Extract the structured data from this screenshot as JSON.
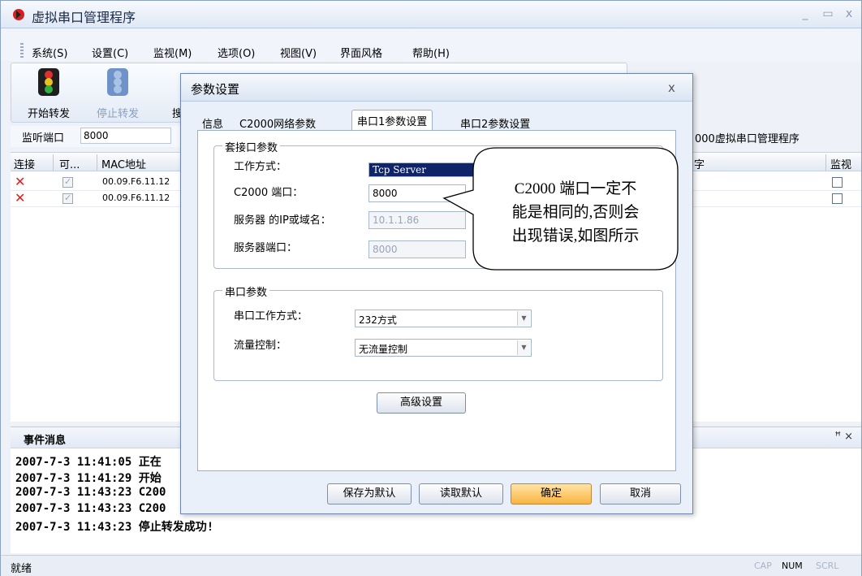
{
  "app": {
    "title": "虚拟串口管理程序"
  },
  "menu": [
    "系统(S)",
    "设置(C)",
    "监视(M)",
    "选项(O)",
    "视图(V)",
    "界面风格",
    "帮助(H)"
  ],
  "toolbar": {
    "start_label": "开始转发",
    "stop_label": "停止转发",
    "search_label": "搜索"
  },
  "addressbar": {
    "label": "监听端口",
    "value": "8000",
    "right_text": "000虚拟串口管理程序"
  },
  "grid": {
    "headers": [
      "连接",
      "可...",
      "MAC地址",
      "字",
      "监视"
    ],
    "rows": [
      {
        "mac": "00.09.F6.11.12"
      },
      {
        "mac": "00.09.F6.11.12"
      }
    ]
  },
  "events": {
    "title": "事件消息",
    "controls": "ꟸ ×",
    "lines": [
      "2007-7-3 11:41:05  正在",
      "2007-7-3 11:41:29  开始",
      "2007-7-3 11:43:23  C200",
      "2007-7-3 11:43:23  C200",
      "2007-7-3 11:43:23  停止转发成功!"
    ]
  },
  "status": {
    "text": "就绪",
    "indicators": [
      "CAP",
      "NUM",
      "SCRL"
    ]
  },
  "dialog": {
    "title": "参数设置",
    "close": "x",
    "tabs": [
      "信息",
      "C2000网络参数",
      "串口1参数设置",
      "串口2参数设置"
    ],
    "socket_group": {
      "title": "套接口参数",
      "work_mode_label": "工作方式：",
      "work_mode_value": "Tcp Server",
      "port_label": "C2000 端口：",
      "port_value": "8000",
      "server_ip_label": "服务器 的IP或域名：",
      "server_ip_value": "10.1.1.86",
      "server_port_label": "服务器端口：",
      "server_port_value": "8000"
    },
    "serial_group": {
      "title": "串口参数",
      "mode_label": "串口工作方式：",
      "mode_value": "232方式",
      "flow_label": "流量控制：",
      "flow_value": "无流量控制"
    },
    "advanced_label": "高级设置",
    "buttons": {
      "save_default": "保存为默认",
      "read_default": "读取默认",
      "ok": "确定",
      "cancel": "取消"
    }
  },
  "callout": {
    "lines": [
      "C2000 端口一定不",
      "能是相同的,否则会",
      "出现错误,如图所示"
    ]
  }
}
